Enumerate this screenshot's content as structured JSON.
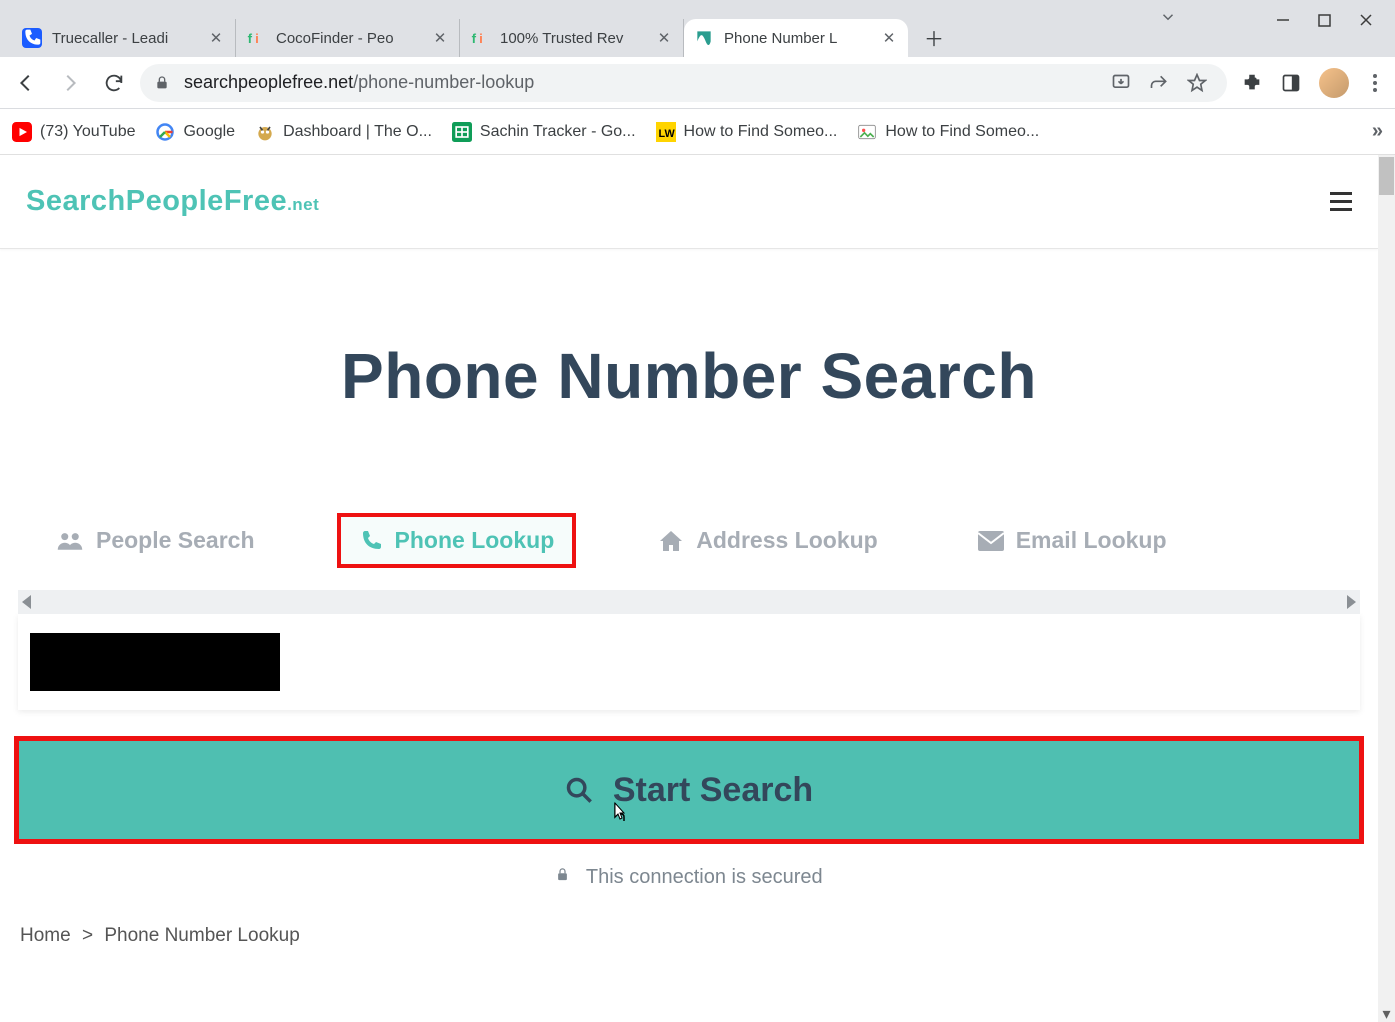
{
  "tabs": [
    {
      "title": "Truecaller - Leadi"
    },
    {
      "title": "CocoFinder - Peo"
    },
    {
      "title": "100% Trusted Rev"
    },
    {
      "title": "Phone Number L"
    }
  ],
  "url": {
    "domain": "searchpeoplefree.net",
    "path": "/phone-number-lookup"
  },
  "bookmarks": [
    {
      "label": "(73) YouTube"
    },
    {
      "label": "Google"
    },
    {
      "label": "Dashboard | The O..."
    },
    {
      "label": "Sachin Tracker - Go..."
    },
    {
      "label": "How to Find Someo..."
    },
    {
      "label": "How to Find Someo..."
    }
  ],
  "site": {
    "logo_main": "SearchPeopleFree",
    "logo_suffix": ".net"
  },
  "hero": {
    "title": "Phone Number Search"
  },
  "search_tabs": {
    "people": "People Search",
    "phone": "Phone Lookup",
    "address": "Address Lookup",
    "email": "Email Lookup"
  },
  "start_button": "Start Search",
  "secure_text": "This connection is secured",
  "breadcrumb": {
    "home": "Home",
    "sep": ">",
    "current": "Phone Number Lookup"
  }
}
